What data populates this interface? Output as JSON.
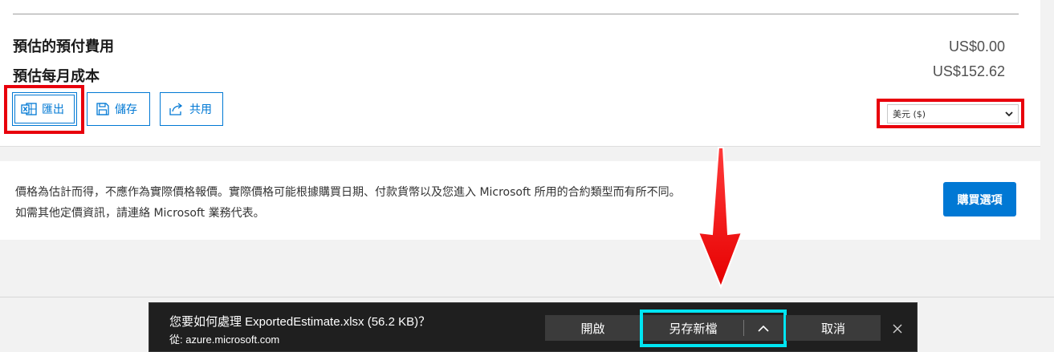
{
  "summary": {
    "upfront_label": "預估的預付費用",
    "upfront_value": "US$0.00",
    "monthly_label": "預估每月成本",
    "monthly_value": "US$152.62"
  },
  "actions": {
    "export_label": "匯出",
    "save_label": "儲存",
    "share_label": "共用"
  },
  "currency": {
    "selected": "美元 ($)"
  },
  "notice": {
    "text": "價格為估計而得，不應作為實際價格報價。實際價格可能根據購買日期、付款貨幣以及您進入 Microsoft 所用的合約類型而有所不同。如需其他定價資訊，請連絡 Microsoft 業務代表。",
    "buy_label": "購買選項"
  },
  "download_bar": {
    "prompt": "您要如何處理 ExportedEstimate.xlsx (56.2 KB)？",
    "source": "從: azure.microsoft.com",
    "open_label": "開啟",
    "save_as_label": "另存新檔",
    "cancel_label": "取消"
  },
  "colors": {
    "accent": "#0078d4",
    "highlight_red": "#e8000c",
    "highlight_cyan": "#00e5f2",
    "download_bar_bg": "#1f1f1f"
  },
  "icons": {
    "export": "excel-icon",
    "save": "save-icon",
    "share": "share-icon",
    "select": "chevron-down-icon",
    "split": "chevron-up-icon",
    "close": "close-icon",
    "annotation": "red-arrow-down"
  }
}
